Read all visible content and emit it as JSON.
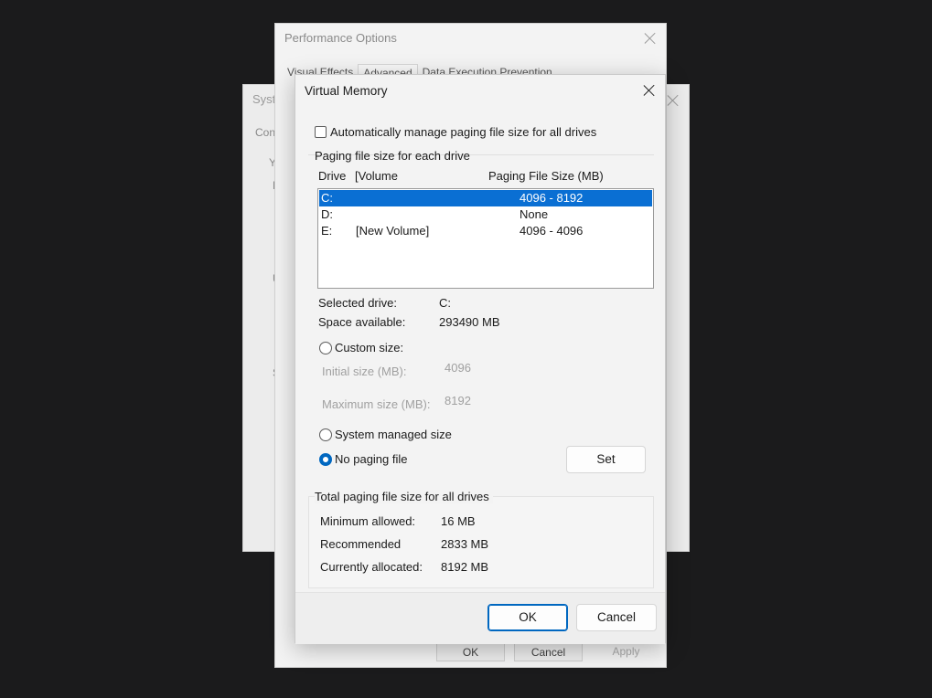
{
  "system_window": {
    "title_fragment": "Syste",
    "fragments": [
      "Con",
      "Y",
      "P",
      "U",
      "S"
    ]
  },
  "performance_window": {
    "title": "Performance Options",
    "tabs": [
      {
        "label": "Visual Effects"
      },
      {
        "label": "Advanced"
      },
      {
        "label": "Data Execution Prevention"
      }
    ],
    "ok_label": "OK",
    "cancel_label": "Cancel",
    "apply_label": "Apply"
  },
  "virtual_memory": {
    "title": "Virtual Memory",
    "auto_manage_label": "Automatically manage paging file size for all drives",
    "auto_manage_checked": false,
    "section_title": "Paging file size for each drive",
    "columns": {
      "drive": "Drive",
      "volume": "[Volume",
      "size": "Paging File Size (MB)"
    },
    "drives": [
      {
        "drive": "C:",
        "volume": "",
        "size": "4096 - 8192",
        "selected": true
      },
      {
        "drive": "D:",
        "volume": "",
        "size": "None",
        "selected": false
      },
      {
        "drive": "E:",
        "volume": "[New Volume]",
        "size": "4096 - 4096",
        "selected": false
      }
    ],
    "selected_drive_label": "Selected drive:",
    "selected_drive_value": "C:",
    "space_available_label": "Space available:",
    "space_available_value": "293490 MB",
    "custom_size_label": "Custom size:",
    "initial_size_label": "Initial size (MB):",
    "initial_size_value": "4096",
    "maximum_size_label": "Maximum size (MB):",
    "maximum_size_value": "8192",
    "system_managed_label": "System managed size",
    "no_paging_label": "No paging file",
    "selected_option": "no_paging",
    "set_label": "Set",
    "totals_title": "Total paging file size for all drives",
    "minimum_allowed_label": "Minimum allowed:",
    "minimum_allowed_value": "16 MB",
    "recommended_label": "Recommended",
    "recommended_value": "2833 MB",
    "currently_allocated_label": "Currently allocated:",
    "currently_allocated_value": "8192 MB",
    "ok_label": "OK",
    "cancel_label": "Cancel"
  },
  "colors": {
    "accent": "#0067c0",
    "selection": "#0a6fd3",
    "backdrop": "#1b1b1c"
  }
}
